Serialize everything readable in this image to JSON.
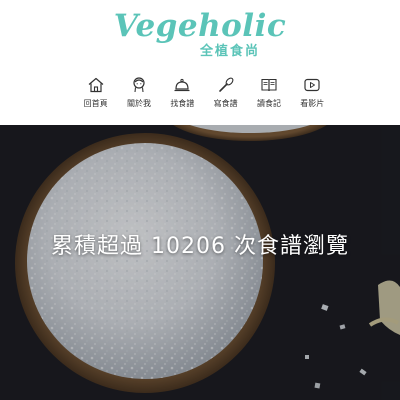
{
  "logo": {
    "brand": "Vegeholic",
    "tagline": "全植食尚"
  },
  "nav": {
    "items": [
      {
        "label": "回首頁",
        "icon": "home-icon"
      },
      {
        "label": "關於我",
        "icon": "avatar-icon"
      },
      {
        "label": "找食譜",
        "icon": "cloche-icon"
      },
      {
        "label": "寫食譜",
        "icon": "whisk-icon"
      },
      {
        "label": "讀食記",
        "icon": "book-icon"
      },
      {
        "label": "看影片",
        "icon": "video-play-icon"
      }
    ]
  },
  "hero": {
    "headline": "累積超過 10206 次食譜瀏覽"
  },
  "colors": {
    "brand": "#5bc4b8",
    "nav_text": "#333333",
    "hero_bg": "#1b1c21"
  }
}
